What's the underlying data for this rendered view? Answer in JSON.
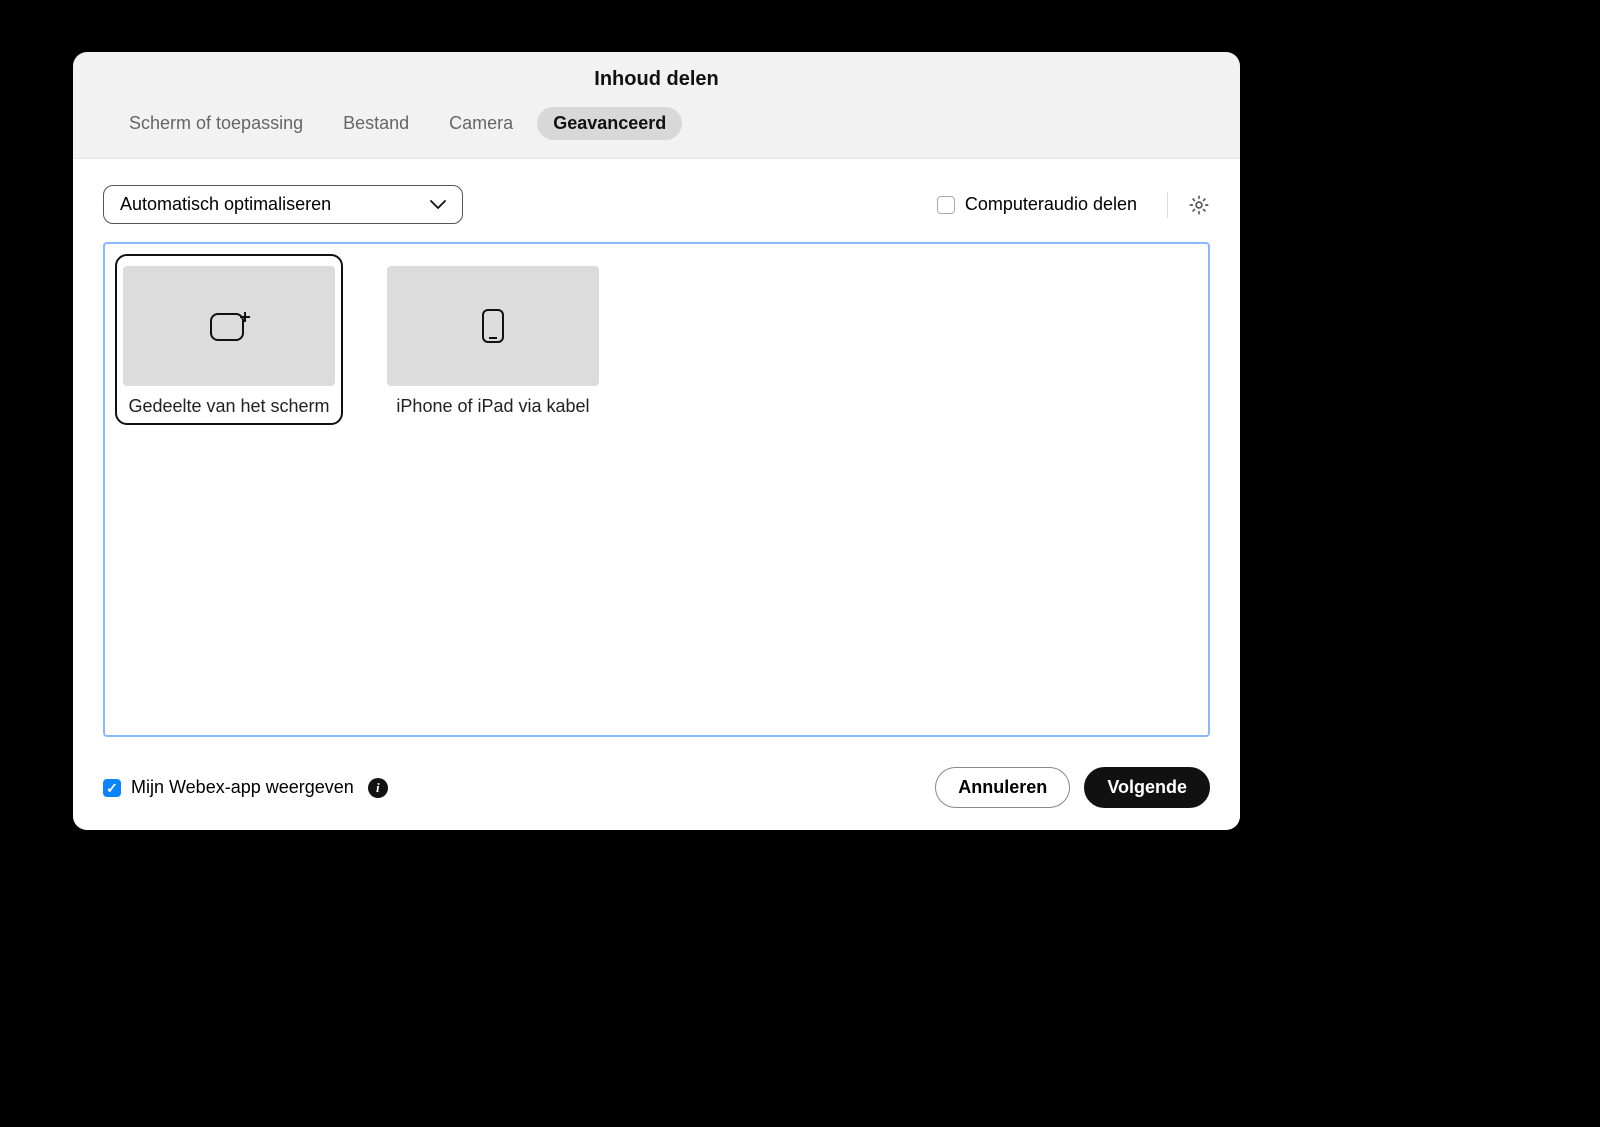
{
  "dialog": {
    "title": "Inhoud delen"
  },
  "tabs": [
    {
      "label": "Scherm of toepassing",
      "active": false
    },
    {
      "label": "Bestand",
      "active": false
    },
    {
      "label": "Camera",
      "active": false
    },
    {
      "label": "Geavanceerd",
      "active": true
    }
  ],
  "toolbar": {
    "optimize_dropdown": "Automatisch optimaliseren",
    "share_audio_label": "Computeraudio delen",
    "share_audio_checked": false
  },
  "options": [
    {
      "id": "partial-screen",
      "label": "Gedeelte van het scherm",
      "selected": true,
      "icon": "share-region"
    },
    {
      "id": "iphone-ipad-cable",
      "label": "iPhone of iPad via kabel",
      "selected": false,
      "icon": "device"
    }
  ],
  "footer": {
    "show_webex_label": "Mijn Webex-app weergeven",
    "show_webex_checked": true,
    "cancel_label": "Annuleren",
    "next_label": "Volgende"
  }
}
